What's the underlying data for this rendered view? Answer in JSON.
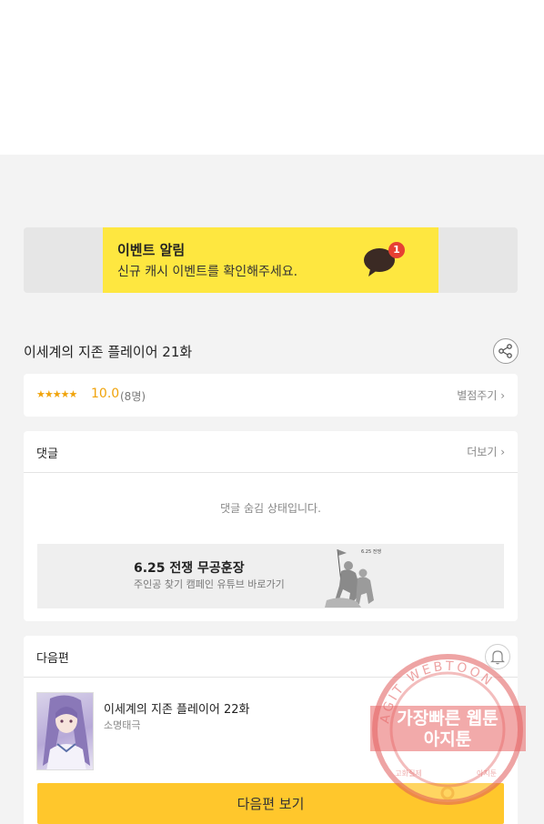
{
  "event": {
    "title": "이벤트 알림",
    "subtitle": "신규 캐시 이벤트를 확인해주세요.",
    "badge_count": "1",
    "icon": "chat-bubble-icon"
  },
  "episode": {
    "title": "이세계의 지존 플레이어 21화",
    "share_icon": "share-icon"
  },
  "rating": {
    "stars": "★★★★★",
    "score": "10.0",
    "count": "(8명)",
    "rate_label": "별점주기 ›"
  },
  "comments": {
    "label": "댓글",
    "more_label": "더보기 ›",
    "hidden_message": "댓글 숨김 상태입니다.",
    "ad": {
      "title": "6.25 전쟁 무공훈장",
      "subtitle": "주인공 찾기 캠페인 유튜브 바로가기",
      "logo_text": "6.25 전쟁"
    }
  },
  "next": {
    "label": "다음편",
    "bell_icon": "bell-icon",
    "episode_title": "이세계의 지존 플레이어 22화",
    "author": "소명태극",
    "button_label": "다음편 보기"
  },
  "watermark": {
    "arc_text": "AGIT WEBTOON",
    "line1": "가장빠른 웹툰",
    "line2": "아지툰",
    "bottom_left": "고화질제",
    "bottom_right": "아지툰"
  },
  "colors": {
    "accent_yellow": "#fee740",
    "button_yellow": "#ffc72c",
    "star_orange": "#f0a30a",
    "badge_red": "#e64033"
  }
}
